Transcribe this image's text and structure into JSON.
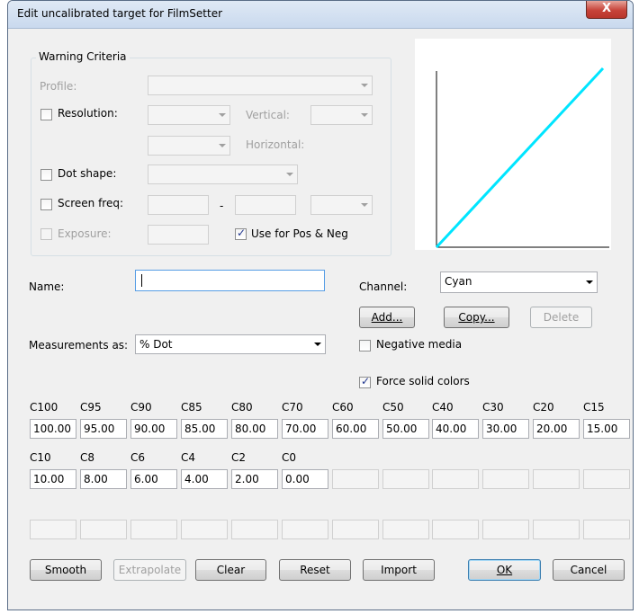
{
  "window": {
    "title": "Edit uncalibrated target for FilmSetter",
    "close_glyph": "X"
  },
  "warning": {
    "legend": "Warning Criteria",
    "profile_label": "Profile:",
    "resolution_label": "Resolution:",
    "vertical_label": "Vertical:",
    "horizontal_label": "Horizontal:",
    "dot_shape_label": "Dot shape:",
    "screen_freq_label": "Screen freq:",
    "screen_freq_dash": "-",
    "exposure_label": "Exposure:",
    "use_pos_neg_label": "Use for Pos & Neg"
  },
  "form": {
    "name_label": "Name:",
    "name_value": "",
    "channel_label": "Channel:",
    "channel_value": "Cyan",
    "measurements_label": "Measurements as:",
    "measurements_value": "% Dot",
    "negative_media_label": "Negative media",
    "force_solid_label": "Force solid colors"
  },
  "buttons": {
    "add": "Add...",
    "copy": "Copy...",
    "delete": "Delete",
    "smooth": "Smooth",
    "extrapolate": "Extrapolate",
    "clear": "Clear",
    "reset": "Reset",
    "import": "Import",
    "ok": "OK",
    "cancel": "Cancel"
  },
  "table": {
    "row1_headers": [
      "C100",
      "C95",
      "C90",
      "C85",
      "C80",
      "C70",
      "C60",
      "C50",
      "C40",
      "C30",
      "C20",
      "C15"
    ],
    "row1_values": [
      "100.00",
      "95.00",
      "90.00",
      "85.00",
      "80.00",
      "70.00",
      "60.00",
      "50.00",
      "40.00",
      "30.00",
      "20.00",
      "15.00"
    ],
    "row2_headers": [
      "C10",
      "C8",
      "C6",
      "C4",
      "C2",
      "C0"
    ],
    "row2_values": [
      "10.00",
      "8.00",
      "6.00",
      "4.00",
      "2.00",
      "0.00"
    ]
  },
  "colors": {
    "curve": "#00e5ff",
    "window_bg": "#f0f0f0"
  }
}
